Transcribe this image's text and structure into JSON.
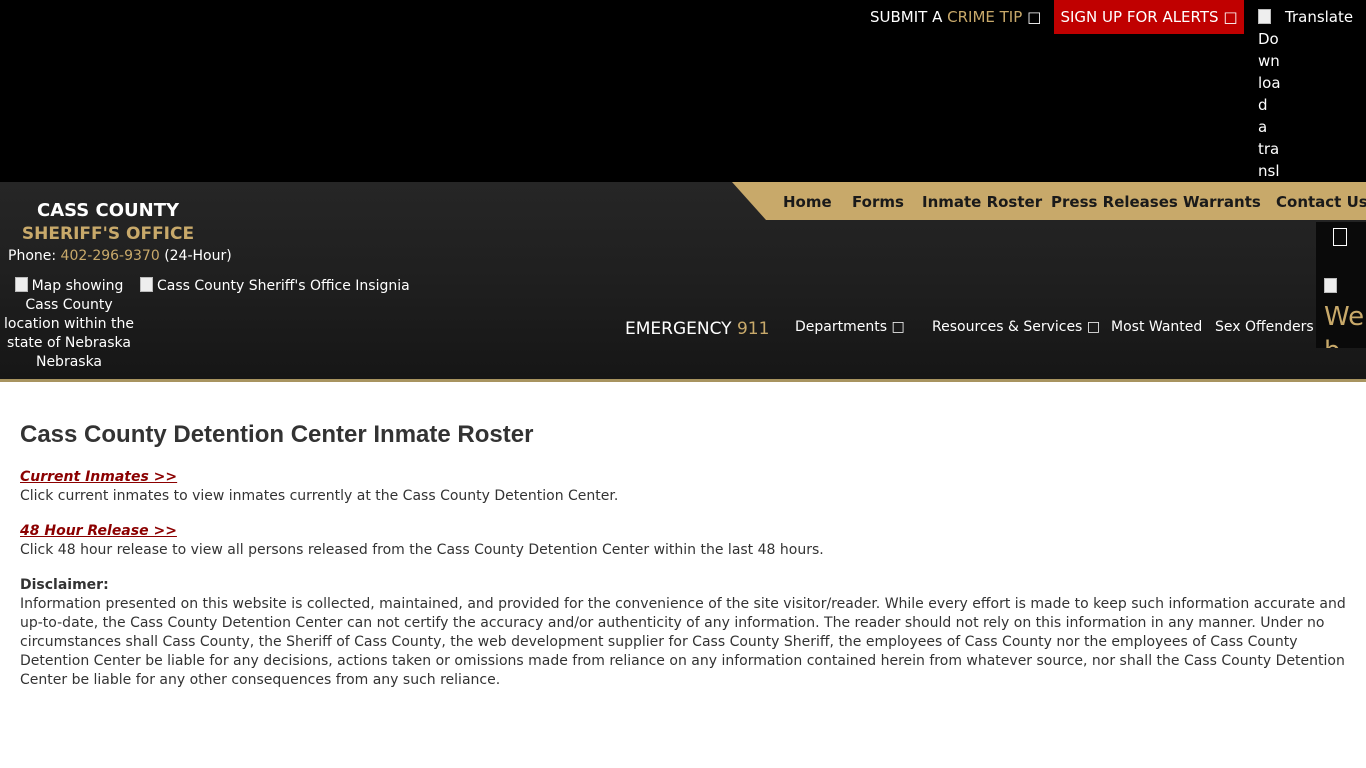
{
  "topbar": {
    "crime_tip_prefix": "SUBMIT A",
    "crime_tip_accent": "CRIME TIP",
    "crime_tip_icon": "external-link-icon",
    "alerts_label": "SIGN UP FOR ALERTS",
    "translate_img_alt": "Download a translation extension for your browser",
    "translate_label": "Translate"
  },
  "brand": {
    "name": "CASS COUNTY",
    "subtitle": "SHERIFF'S OFFICE",
    "phone_label": "Phone:",
    "phone_number": "402-296-9370",
    "phone_note": "(24-Hour)",
    "map_alt_line1": "Map showing Cass County location within the state of Nebraska",
    "map_alt_line2": "Nebraska",
    "insignia_alt": "Cass County Sheriff's Office Insignia"
  },
  "main_nav": [
    {
      "label": "Home"
    },
    {
      "label": "Forms"
    },
    {
      "label": "Inmate Roster"
    },
    {
      "label": "Press Releases"
    },
    {
      "label": "Warrants"
    },
    {
      "label": "Contact Us"
    }
  ],
  "secondary_nav": {
    "emergency_label": "EMERGENCY",
    "emergency_number": "911",
    "items": [
      {
        "label": "Departments"
      },
      {
        "label": "Resources & Services"
      },
      {
        "label": "Most Wanted"
      },
      {
        "label": "Sex Offenders"
      }
    ]
  },
  "side_widget": {
    "accessibility_alt": "Web Accessibility"
  },
  "content": {
    "title": "Cass County Detention Center Inmate Roster",
    "links": [
      {
        "label": "Current Inmates >>",
        "description": "Click current inmates to view inmates currently at the Cass County Detention Center."
      },
      {
        "label": "48 Hour Release >>",
        "description": "Click 48 hour release to view all persons released from the Cass County Detention Center within the last 48 hours."
      }
    ],
    "disclaimer_title": "Disclaimer:",
    "disclaimer_text": "Information presented on this website is collected, maintained, and provided for the convenience of the site visitor/reader. While every effort is made to keep such information accurate and up-to-date, the Cass County Detention Center can not certify the accuracy and/or authenticity of any information. The reader should not rely on this information in any manner.  Under no circumstances shall Cass County, the Sheriff of Cass County, the web development supplier for Cass County Sheriff, the employees of Cass County nor the employees of Cass County Detention Center be liable for any decisions, actions taken or omissions made from reliance on any information contained herein from whatever source, nor shall the Cass County Detention Center be liable for any other consequences from any such reliance."
  },
  "colors": {
    "gold_accent": "#c8a96a",
    "alert_red": "#c00000",
    "link_red": "#8b0000",
    "header_dark": "#1f1f1f"
  }
}
